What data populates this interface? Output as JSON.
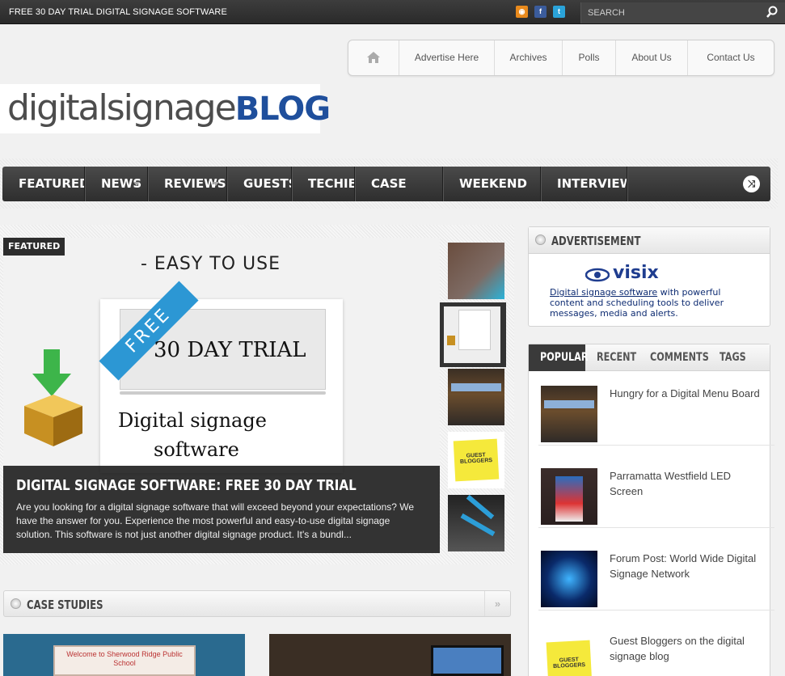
{
  "topbar": {
    "promo": "FREE 30 DAY TRIAL DIGITAL SIGNAGE SOFTWARE",
    "search_placeholder": "SEARCH",
    "social_icons": [
      "rss-icon",
      "facebook-icon",
      "twitter-icon"
    ]
  },
  "header": {
    "nav": [
      "Advertise Here",
      "Archives",
      "Polls",
      "About Us",
      "Contact Us"
    ],
    "logo_light": "digitalsignage",
    "logo_bold": "BLOG"
  },
  "mainnav": {
    "items": [
      "FEATURED",
      "NEWS",
      "REVIEWS",
      "GUESTS",
      "TECHIE",
      "CASE STUDY",
      "WEEKEND FUN",
      "INTERVIEWS"
    ]
  },
  "slider": {
    "tag": "FEATURED",
    "slide_text_top": "- EASY TO USE",
    "ribbon": "FREE",
    "trial": "30 DAY TRIAL",
    "line1": "Digital signage",
    "line2": "software",
    "caption_title": "DIGITAL SIGNAGE SOFTWARE: FREE 30 DAY TRIAL",
    "caption_text": "Are you looking for a digital signage software that will exceed beyond your expectations? We have the answer for you. Experience the most powerful and easy-to-use digital signage solution. This software is not just another digital signage product. It's a bundl...",
    "thumb_note": "GUEST BLOGGERS"
  },
  "case_studies": {
    "title": "CASE STUDIES",
    "more": "»",
    "thumb1_text": "Welcome to Sherwood Ridge Public School"
  },
  "advertisement": {
    "title": "ADVERTISEMENT",
    "brand": "visix",
    "link_text": "Digital signage software",
    "text": " with powerful content and scheduling tools to deliver messages, media and alerts."
  },
  "tabs_widget": {
    "tabs": [
      "POPULAR",
      "RECENT",
      "COMMENTS",
      "TAGS"
    ],
    "posts": [
      "Hungry for a Digital Menu Board",
      "Parramatta Westfield LED Screen",
      "Forum Post: World Wide Digital Signage Network",
      "Guest Bloggers on the digital signage blog"
    ]
  }
}
